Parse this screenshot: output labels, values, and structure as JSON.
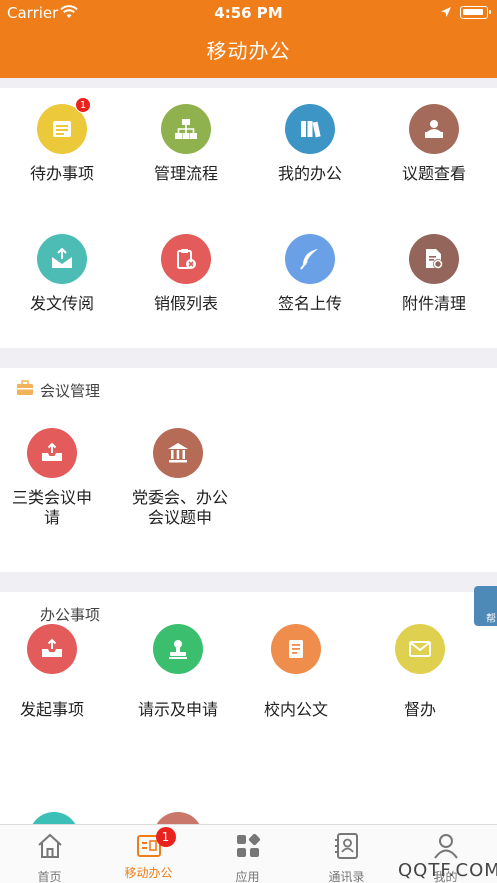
{
  "status": {
    "carrier": "Carrier",
    "time": "4:56 PM"
  },
  "nav": {
    "title": "移动办公"
  },
  "grid1": [
    {
      "label": "待办事项",
      "icon": "todo-list-icon",
      "color": "#ecc93b",
      "badge": "1"
    },
    {
      "label": "管理流程",
      "icon": "org-flow-icon",
      "color": "#8fb24e"
    },
    {
      "label": "我的办公",
      "icon": "books-icon",
      "color": "#3d95c6"
    },
    {
      "label": "议题查看",
      "icon": "podium-speaker-icon",
      "color": "#a46b5a"
    },
    {
      "label": "发文传阅",
      "icon": "mail-upload-icon",
      "color": "#4dbcb4"
    },
    {
      "label": "销假列表",
      "icon": "clipboard-cancel-icon",
      "color": "#e35b5b"
    },
    {
      "label": "签名上传",
      "icon": "feather-pen-icon",
      "color": "#6aa0e6"
    },
    {
      "label": "附件清理",
      "icon": "file-gear-icon",
      "color": "#94655b"
    }
  ],
  "meeting": {
    "title": "会议管理",
    "items": [
      {
        "label": "三类会议申请",
        "icon": "tray-upload-icon",
        "color": "#e35b5b"
      },
      {
        "label": "党委会、办公会议题申",
        "icon": "building-columns-icon",
        "color": "#b66b57"
      }
    ]
  },
  "office": {
    "title": "办公事项",
    "items": [
      {
        "label": "发起事项",
        "icon": "tray-upload-icon",
        "color": "#e35b5b"
      },
      {
        "label": "请示及申请",
        "icon": "stamp-icon",
        "color": "#3bbf6f"
      },
      {
        "label": "校内公文",
        "icon": "document-icon",
        "color": "#ef8d4d"
      },
      {
        "label": "督办",
        "icon": "envelope-icon",
        "color": "#dfd04f"
      }
    ]
  },
  "floating": {
    "label": "帮"
  },
  "tabbar": [
    {
      "label": "首页",
      "icon": "home-icon"
    },
    {
      "label": "移动办公",
      "icon": "office-card-icon",
      "active": true,
      "badge": "1"
    },
    {
      "label": "应用",
      "icon": "apps-grid-icon"
    },
    {
      "label": "通讯录",
      "icon": "contacts-book-icon"
    },
    {
      "label": "我的",
      "icon": "user-icon"
    }
  ],
  "watermark": "QQTF.COM",
  "colors": {
    "brand": "#ef7d1a",
    "badge": "#e8231e"
  }
}
